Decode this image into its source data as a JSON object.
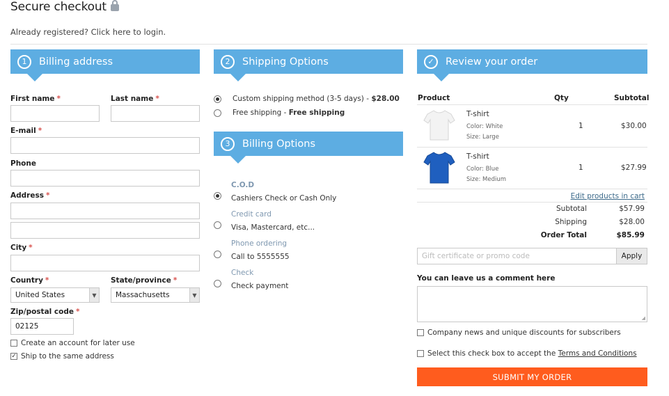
{
  "header": {
    "title": "Secure checkout",
    "login_text": "Already registered? Click here to login."
  },
  "billing": {
    "step": "1",
    "title": "Billing address",
    "first_name": "First name",
    "last_name": "Last name",
    "email": "E-mail",
    "phone": "Phone",
    "address": "Address",
    "city": "City",
    "country": "Country",
    "country_value": "United States",
    "state": "State/province",
    "state_value": "Massachusetts",
    "zip": "Zip/postal code",
    "zip_value": "02125",
    "create_account": "Create an account for later use",
    "ship_same": "Ship to the same address",
    "required_mark": "*"
  },
  "shipping": {
    "step": "2",
    "title": "Shipping Options",
    "opt1_text": "Custom shipping method (3-5 days) - ",
    "opt1_price": "$28.00",
    "opt2_text": "Free shipping - ",
    "opt2_price": "Free shipping"
  },
  "payment": {
    "step": "3",
    "title": "Billing Options",
    "methods": [
      {
        "title": "C.O.D",
        "text": "Cashiers Check or Cash Only"
      },
      {
        "title": "Credit card",
        "text": "Visa, Mastercard, etc..."
      },
      {
        "title": "Phone ordering",
        "text": "Call to 5555555"
      },
      {
        "title": "Check",
        "text": "Check payment"
      }
    ]
  },
  "review": {
    "title": "Review your order",
    "col_product": "Product",
    "col_qty": "Qty",
    "col_subtotal": "Subtotal",
    "items": [
      {
        "name": "T-shirt",
        "color": "Color: White",
        "size": "Size: Large",
        "qty": "1",
        "subtotal": "$30.00",
        "shirt_color": "#f4f4f4"
      },
      {
        "name": "T-shirt",
        "color": "Color: Blue",
        "size": "Size: Medium",
        "qty": "1",
        "subtotal": "$27.99",
        "shirt_color": "#1f5fbf"
      }
    ],
    "edit_link": "Edit products in cart",
    "subtotal_label": "Subtotal",
    "subtotal_value": "$57.99",
    "shipping_label": "Shipping",
    "shipping_value": "$28.00",
    "total_label": "Order Total",
    "total_value": "$85.99",
    "promo_placeholder": "Gift certificate or promo code",
    "apply": "Apply",
    "comment_label": "You can leave us a comment here",
    "newsletter": "Company news and unique discounts for subscribers",
    "terms_prefix": "Select this check box to accept the ",
    "terms_link": "Terms and Conditions",
    "submit": "SUBMIT MY ORDER"
  },
  "colors": {
    "accent": "#5dade2",
    "submit": "#ff5c1e",
    "required": "#d9534f"
  }
}
